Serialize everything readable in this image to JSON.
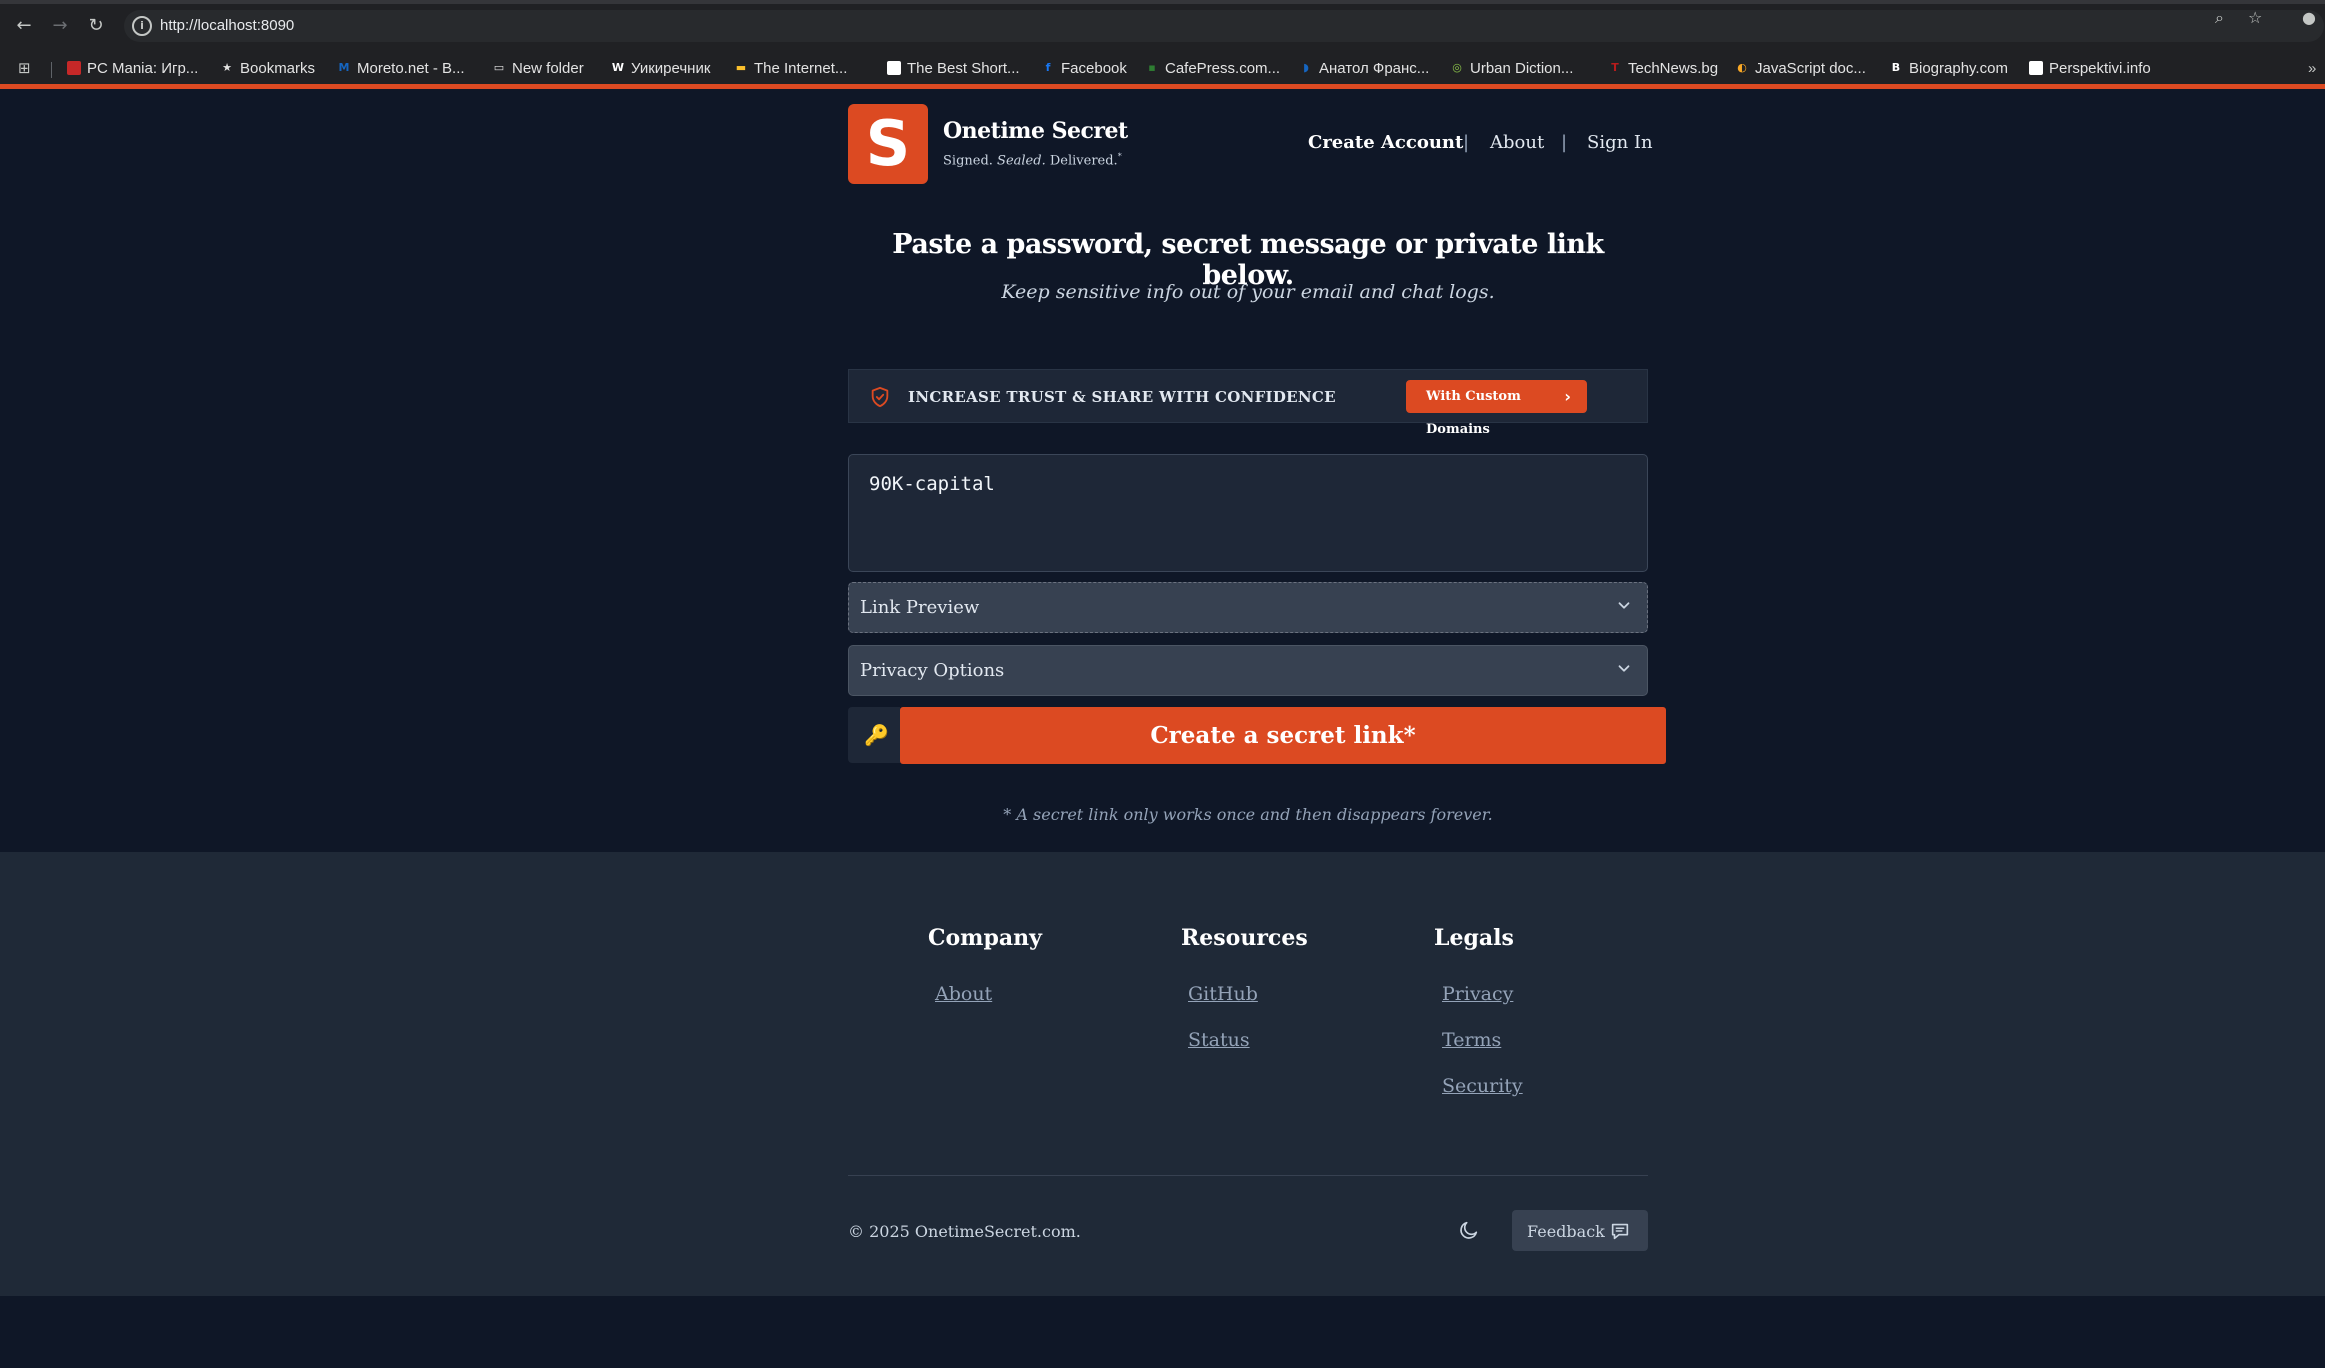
{
  "browser": {
    "url": "http://localhost:8090",
    "bookmarks": [
      {
        "label": "PC Mania: Игр...",
        "icon": "flag-favicon",
        "color": "#c62828"
      },
      {
        "label": "Bookmarks",
        "icon": "star-icon",
        "color": "#e3e3e3"
      },
      {
        "label": "Moreto.net - B...",
        "icon": "m-favicon",
        "color": "#1565c0"
      },
      {
        "label": "New folder",
        "icon": "folder-icon",
        "color": "#e3e3e3"
      },
      {
        "label": "Уикиречник",
        "icon": "w-favicon",
        "color": "#ffffff"
      },
      {
        "label": "The Internet...",
        "icon": "archive-favicon",
        "color": "#fbc02d"
      },
      {
        "label": "The Best Short...",
        "icon": "page-favicon",
        "color": "#ffffff"
      },
      {
        "label": "Facebook",
        "icon": "facebook-favicon",
        "color": "#1877f2"
      },
      {
        "label": "CafePress.com...",
        "icon": "cafepress-favicon",
        "color": "#2e7d32"
      },
      {
        "label": "Анатол Франс...",
        "icon": "sound-favicon",
        "color": "#1565c0"
      },
      {
        "label": "Urban Diction...",
        "icon": "urban-favicon",
        "color": "#8bc34a"
      },
      {
        "label": "TechNews.bg",
        "icon": "technews-favicon",
        "color": "#b71c1c"
      },
      {
        "label": "JavaScript doc...",
        "icon": "js-favicon",
        "color": "#f9a825"
      },
      {
        "label": "Biography.com",
        "icon": "b-favicon",
        "color": "#ffffff"
      },
      {
        "label": "Perspektivi.info",
        "icon": "page-favicon",
        "color": "#ffffff"
      }
    ],
    "more_bookmarks": "»"
  },
  "header": {
    "logo_letter": "S",
    "brand_name": "Onetime Secret",
    "tagline_signed": "Signed.",
    "tagline_sealed": "Sealed.",
    "tagline_delivered": "Delivered.",
    "tagline_mark": "*",
    "nav": {
      "create_account": "Create Account",
      "about": "About",
      "sign_in": "Sign In",
      "separator": "|"
    }
  },
  "main": {
    "headline": "Paste a password, secret message or private link below.",
    "subhead": "Keep sensitive info out of your email and chat logs.",
    "promo": {
      "text": "INCREASE TRUST & SHARE WITH CONFIDENCE",
      "button": "With Custom Domains"
    },
    "secret_value": "90K-capital",
    "link_preview_label": "Link Preview",
    "privacy_options_label": "Privacy Options",
    "create_button": "Create a secret link*",
    "footnote": "* A secret link only works once and then disappears forever."
  },
  "footer": {
    "columns": [
      {
        "title": "Company",
        "links": [
          "About"
        ]
      },
      {
        "title": "Resources",
        "links": [
          "GitHub",
          "Status"
        ]
      },
      {
        "title": "Legals",
        "links": [
          "Privacy",
          "Terms",
          "Security"
        ]
      }
    ],
    "copyright": "© 2025 OnetimeSecret.com.",
    "feedback": "Feedback"
  },
  "colors": {
    "brand": "#dc4a22",
    "page_bg": "#0f1727",
    "footer_bg": "#1f2937"
  }
}
